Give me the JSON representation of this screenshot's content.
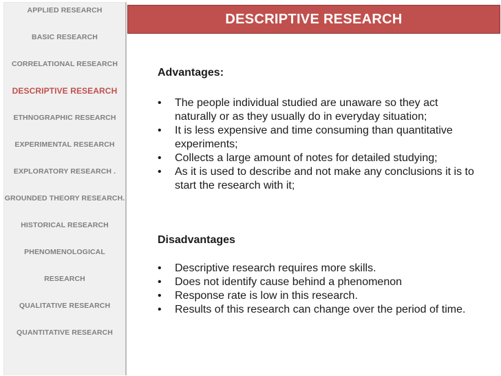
{
  "sidebar": {
    "items": [
      {
        "label": "APPLIED RESEARCH"
      },
      {
        "label": "BASIC RESEARCH"
      },
      {
        "label": "CORRELATIONAL RESEARCH"
      },
      {
        "label": "DESCRIPTIVE RESEARCH",
        "active": true
      },
      {
        "label": "ETHNOGRAPHIC RESEARCH"
      },
      {
        "label": "EXPERIMENTAL RESEARCH"
      },
      {
        "label": "EXPLORATORY RESEARCH ."
      },
      {
        "label": "GROUNDED THEORY RESEARCH."
      },
      {
        "label": "HISTORICAL RESEARCH"
      },
      {
        "label": "PHENOMENOLOGICAL"
      },
      {
        "label": "RESEARCH"
      },
      {
        "label": "QUALITATIVE RESEARCH"
      },
      {
        "label": "QUANTITATIVE RESEARCH"
      }
    ]
  },
  "header": {
    "title": "DESCRIPTIVE RESEARCH",
    "color": "#c0504d"
  },
  "content": {
    "advantages": {
      "title": "Advantages:",
      "bullet": "•",
      "items": [
        "The people individual studied are unaware so they act naturally or as they usually do in everyday situation;",
        "It is less expensive and time consuming than quantitative experiments;",
        "Collects a large amount of notes for detailed studying;",
        "As it is used to describe and not make any conclusions it is to start the research with it;"
      ]
    },
    "disadvantages": {
      "title": "Disadvantages",
      "bullet": "•",
      "items": [
        "Descriptive research requires more skills.",
        "Does not identify cause behind a phenomenon",
        "Response rate is low in this research.",
        "Results of this research can change over the period of time."
      ]
    }
  }
}
